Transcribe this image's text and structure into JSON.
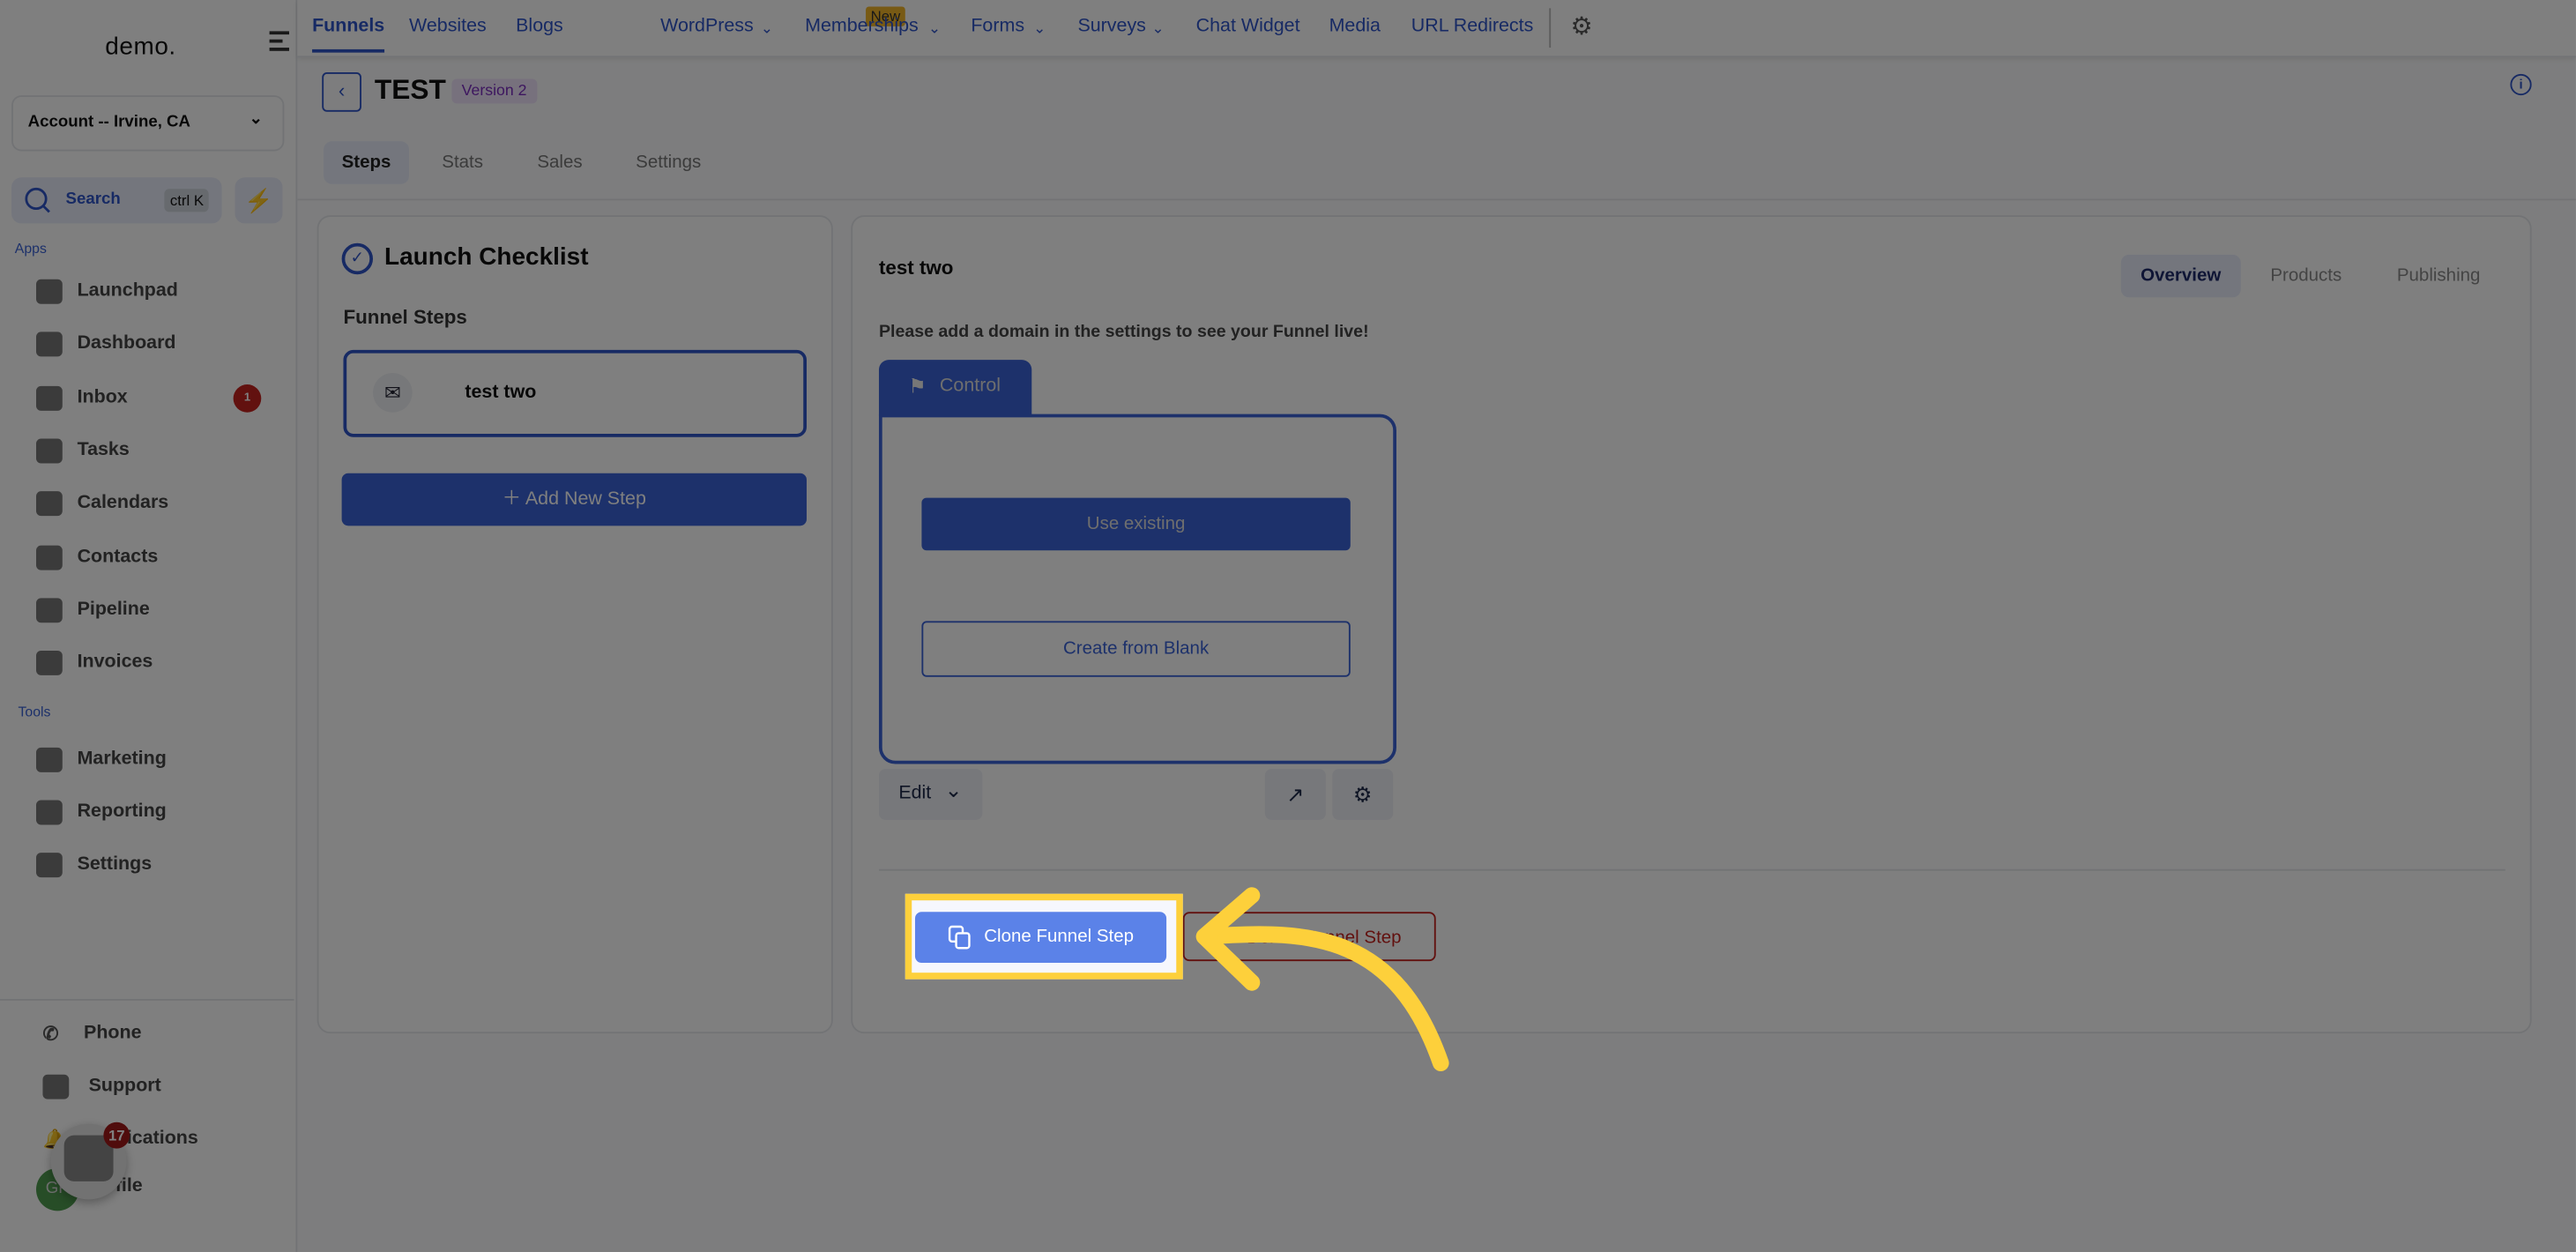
{
  "sidebar": {
    "logo": "demo.",
    "account": "Account -- Irvine, CA",
    "search_label": "Search",
    "search_shortcut": "ctrl K",
    "apps_label": "Apps",
    "tools_label": "Tools",
    "apps": [
      {
        "label": "Launchpad"
      },
      {
        "label": "Dashboard"
      },
      {
        "label": "Inbox",
        "badge": "1"
      },
      {
        "label": "Tasks"
      },
      {
        "label": "Calendars"
      },
      {
        "label": "Contacts"
      },
      {
        "label": "Pipeline"
      },
      {
        "label": "Invoices"
      }
    ],
    "tools": [
      {
        "label": "Marketing"
      },
      {
        "label": "Reporting"
      },
      {
        "label": "Settings"
      }
    ],
    "bottom": [
      {
        "label": "Phone"
      },
      {
        "label": "Support"
      },
      {
        "label": "Notifications"
      },
      {
        "label": "Profile"
      }
    ],
    "avatar_initials": "GP",
    "chat_badge": "17"
  },
  "topnav": {
    "items": [
      "Funnels",
      "Websites",
      "Blogs",
      "WordPress",
      "Memberships",
      "Forms",
      "Surveys",
      "Chat Widget",
      "Media",
      "URL Redirects"
    ],
    "new_badge": "New",
    "active": "Funnels"
  },
  "header": {
    "title": "TEST",
    "version": "Version 2",
    "tabs": [
      "Steps",
      "Stats",
      "Sales",
      "Settings"
    ],
    "active_tab": "Steps"
  },
  "checklist": {
    "title": "Launch Checklist",
    "steps_label": "Funnel Steps",
    "steps": [
      {
        "label": "test two"
      }
    ],
    "add_step": "Add New Step"
  },
  "step_detail": {
    "title": "test two",
    "tabs": [
      "Overview",
      "Products",
      "Publishing"
    ],
    "active_tab": "Overview",
    "notice": "Please add a domain in the settings to see your Funnel live!",
    "variant_tab": "Control",
    "use_existing": "Use existing",
    "create_blank": "Create from Blank",
    "edit": "Edit",
    "clone": "Clone Funnel Step",
    "delete": "Delete Funnel Step"
  },
  "colors": {
    "accent": "#3b63d6",
    "highlight": "#fdd03b",
    "danger": "#c5221f"
  }
}
